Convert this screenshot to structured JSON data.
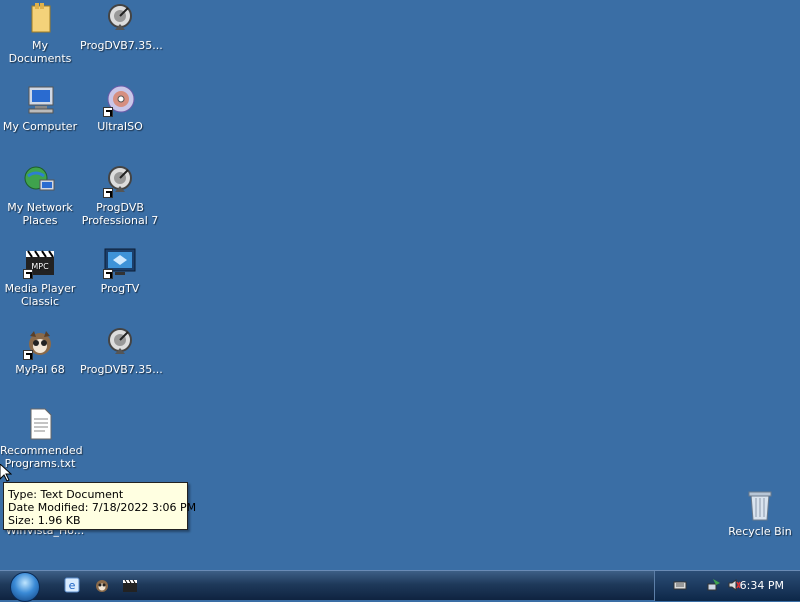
{
  "desktop": {
    "icons": [
      {
        "label": "My Documents",
        "icon": "folder-icon"
      },
      {
        "label": "My Computer",
        "icon": "computer-icon"
      },
      {
        "label": "My Network Places",
        "icon": "network-icon"
      },
      {
        "label": "Media Player Classic",
        "icon": "media-player-icon"
      },
      {
        "label": "MyPal 68",
        "icon": "mypal-icon"
      },
      {
        "label": "Recommended Programs.txt",
        "icon": "text-file-icon"
      },
      {
        "label": "ProgDVB7.35...",
        "icon": "satellite-icon"
      },
      {
        "label": "UltraISO",
        "icon": "disc-icon"
      },
      {
        "label": "ProgDVB Professional 7",
        "icon": "satellite-icon"
      },
      {
        "label": "ProgTV",
        "icon": "tv-icon"
      },
      {
        "label": "ProgDVB7.35...",
        "icon": "satellite-icon"
      },
      {
        "label": "Recycle Bin",
        "icon": "recycle-bin-icon"
      }
    ],
    "hidden_label": "WinVista_Ho..."
  },
  "tooltip": {
    "type": "Type: Text Document",
    "modified": "Date Modified: 7/18/2022 3:06 PM",
    "size": "Size: 1.96 KB"
  },
  "taskbar": {
    "quick_launch": [
      "internet-explorer-icon",
      "mypal-icon",
      "media-player-icon"
    ],
    "tray": [
      "keyboard-icon",
      "network-status-icon",
      "volume-icon"
    ],
    "clock": "6:34 PM"
  }
}
